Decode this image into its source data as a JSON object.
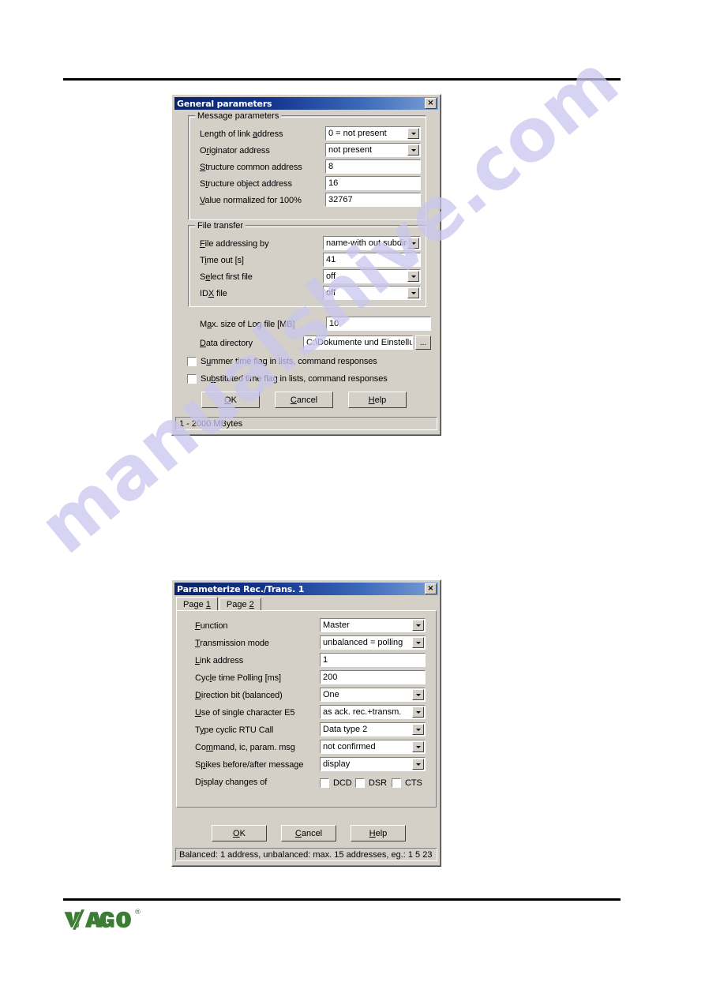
{
  "page": {
    "watermark": "manualshive.com",
    "logo_alt": "WAGO",
    "logo_registered": "®"
  },
  "dialog1": {
    "title": "General parameters",
    "close_label": "×",
    "groups": {
      "message_parameters": {
        "legend": "Message parameters",
        "rows": [
          {
            "label_pre": "Length of link ",
            "label_accel": "a",
            "label_post": "ddress",
            "value": "0 = not present",
            "control": "combo"
          },
          {
            "label_pre": "O",
            "label_accel": "r",
            "label_post": "iginator address",
            "value": "not present",
            "control": "combo"
          },
          {
            "label_pre": "",
            "label_accel": "S",
            "label_post": "tructure common address",
            "value": "8",
            "control": "text"
          },
          {
            "label_pre": "S",
            "label_accel": "t",
            "label_post": "ructure object address",
            "value": "16",
            "control": "text"
          },
          {
            "label_pre": "",
            "label_accel": "V",
            "label_post": "alue normalized for 100%",
            "value": "32767",
            "control": "text"
          }
        ]
      },
      "file_transfer": {
        "legend": "File transfer",
        "rows": [
          {
            "label_pre": "",
            "label_accel": "F",
            "label_post": "ile addressing by",
            "value": "name-with out subdire",
            "control": "combo"
          },
          {
            "label_pre": "T",
            "label_accel": "i",
            "label_post": "me out  [s]",
            "value": "41",
            "control": "text"
          },
          {
            "label_pre": "S",
            "label_accel": "e",
            "label_post": "lect first file",
            "value": "off",
            "control": "combo"
          },
          {
            "label_pre": "ID",
            "label_accel": "X",
            "label_post": " file",
            "value": "off",
            "control": "combo"
          }
        ]
      }
    },
    "log_row": {
      "label_pre": "M",
      "label_accel": "a",
      "label_post": "x. size of Log file  [MB]",
      "value": "10"
    },
    "data_dir_row": {
      "label_pre": "",
      "label_accel": "D",
      "label_post": "ata directory",
      "value": "C:\\Dokumente und Einstellung",
      "browse_label": "..."
    },
    "checkboxes": [
      {
        "label_pre": "S",
        "label_accel": "u",
        "label_post": "mmer time flag in lists, command responses",
        "checked": false
      },
      {
        "label_pre": "Su",
        "label_accel": "b",
        "label_post": "stituted time flag in lists, command responses",
        "checked": false
      }
    ],
    "buttons": [
      {
        "pre": "",
        "accel": "O",
        "post": "K"
      },
      {
        "pre": "",
        "accel": "C",
        "post": "ancel"
      },
      {
        "pre": "",
        "accel": "H",
        "post": "elp"
      }
    ],
    "statusbar": "1 - 2000  MBytes"
  },
  "dialog2": {
    "title": "Parameterize Rec./Trans. 1",
    "close_label": "×",
    "tabs": [
      {
        "pre": "Page ",
        "accel": "1",
        "post": "",
        "active": true
      },
      {
        "pre": "Page ",
        "accel": "2",
        "post": "",
        "active": false
      }
    ],
    "rows": [
      {
        "label_pre": "",
        "label_accel": "F",
        "label_post": "unction",
        "value": "Master",
        "control": "combo"
      },
      {
        "label_pre": "",
        "label_accel": "T",
        "label_post": "ransmission mode",
        "value": "unbalanced = polling",
        "control": "combo"
      },
      {
        "label_pre": "",
        "label_accel": "L",
        "label_post": "ink address",
        "value": "1",
        "control": "text"
      },
      {
        "label_pre": "Cyc",
        "label_accel": "l",
        "label_post": "e time Polling [ms]",
        "value": "200",
        "control": "text"
      },
      {
        "label_pre": "",
        "label_accel": "D",
        "label_post": "irection bit (balanced)",
        "value": "One",
        "control": "combo"
      },
      {
        "label_pre": "",
        "label_accel": "U",
        "label_post": "se of single character E5",
        "value": "as ack. rec.+transm.",
        "control": "combo"
      },
      {
        "label_pre": "T",
        "label_accel": "y",
        "label_post": "pe cyclic RTU Call",
        "value": "Data type 2",
        "control": "combo"
      },
      {
        "label_pre": "Co",
        "label_accel": "m",
        "label_post": "mand, ic, param. msg",
        "value": "not confirmed",
        "control": "combo"
      },
      {
        "label_pre": "S",
        "label_accel": "p",
        "label_post": "ikes before/after message",
        "value": "display",
        "control": "combo"
      }
    ],
    "display_changes": {
      "label_pre": "D",
      "label_accel": "i",
      "label_post": "splay changes of",
      "options": [
        {
          "label": "DCD",
          "checked": false
        },
        {
          "label": "DSR",
          "checked": false
        },
        {
          "label": "CTS",
          "checked": false
        }
      ]
    },
    "buttons": [
      {
        "pre": "",
        "accel": "O",
        "post": "K"
      },
      {
        "pre": "",
        "accel": "C",
        "post": "ancel"
      },
      {
        "pre": "",
        "accel": "H",
        "post": "elp"
      }
    ],
    "statusbar": "Balanced: 1 address, unbalanced: max. 15 addresses, eg.: 1 5 23"
  },
  "colors": {
    "dialog_face": "#d4d0c8",
    "title_left": "#0a246a",
    "title_right": "#7a9fd6",
    "watermark": "#c9c6ee",
    "wago_green": "#3b7d33",
    "rule": "#000000"
  }
}
